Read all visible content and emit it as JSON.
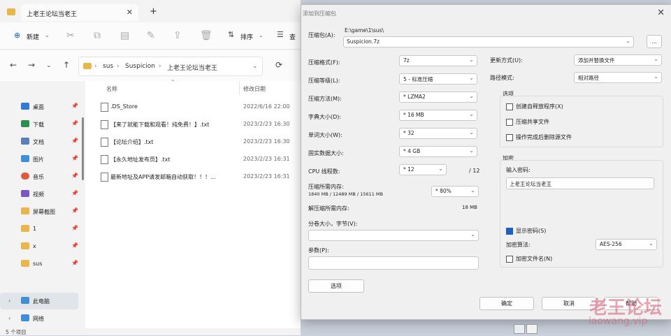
{
  "explorer": {
    "tab_title": "上老王论坛当老王",
    "tab_close": "✕",
    "tab_add": "+",
    "toolbar": {
      "new_label": "新建",
      "sort_label": "排序",
      "view_label": "查"
    },
    "breadcrumb": [
      "sus",
      "Suspicion",
      "上老王论坛当老王"
    ],
    "columns": {
      "name": "名称",
      "date": "修改日期"
    },
    "sidebar": [
      {
        "label": "桌面",
        "color": "#2f7ad6"
      },
      {
        "label": "下载",
        "color": "#2d8f4e"
      },
      {
        "label": "文档",
        "color": "#5b7fb8"
      },
      {
        "label": "图片",
        "color": "#3f8fd8"
      },
      {
        "label": "音乐",
        "color": "#e05a3c"
      },
      {
        "label": "视频",
        "color": "#7b57c4"
      },
      {
        "label": "屏幕截图",
        "color": "#e8b64a"
      },
      {
        "label": "1",
        "color": "#e8b64a"
      },
      {
        "label": "x",
        "color": "#e8b64a"
      },
      {
        "label": "sus",
        "color": "#e8b64a"
      }
    ],
    "this_pc": "此电脑",
    "network": "网络",
    "files": [
      {
        "name": ".DS_Store",
        "date": "2022/6/16 22:00"
      },
      {
        "name": "【来了就能下载和观看！纯免费！】.txt",
        "date": "2023/2/23 16:30"
      },
      {
        "name": "【论坛介绍】.txt",
        "date": "2023/2/23 16:30"
      },
      {
        "name": "【永久地址发布页】.txt",
        "date": "2023/2/23 16:31"
      },
      {
        "name": "最新地址及APP请发邮箱自动获取！！！...",
        "date": "2023/2/23 16:31"
      }
    ],
    "status": "5 个项目"
  },
  "dialog": {
    "title": "添加到压缩包",
    "close": "✕",
    "archive_label": "压缩包(A):",
    "archive_dir": "E:\\game\\1\\sus\\",
    "archive_name": "Suspicion.7z",
    "browse": "...",
    "left": [
      {
        "label": "压缩格式(F):",
        "value": "7z"
      },
      {
        "label": "压缩等级(L):",
        "value": "5 - 标准压缩"
      },
      {
        "label": "压缩方法(M):",
        "value": "* LZMA2"
      },
      {
        "label": "字典大小(D):",
        "value": "* 16 MB"
      },
      {
        "label": "单词大小(W):",
        "value": "* 32"
      },
      {
        "label": "固实数据大小:",
        "value": "* 4 GB"
      }
    ],
    "cpu_label": "CPU 线程数:",
    "cpu_value": "* 12",
    "cpu_max": "/ 12",
    "mem_label": "压缩所需内存:",
    "mem_detail": "1840 MB / 12489 MB / 15611 MB",
    "mem_value": "* 80%",
    "decomp_label": "解压缩所需内存:",
    "decomp_value": "18 MB",
    "split_label": "分卷大小，字节(V):",
    "params_label": "参数(P):",
    "options_btn": "选项",
    "update_label": "更新方式(U):",
    "update_value": "添加并替换文件",
    "path_label": "路径模式:",
    "path_value": "相对路径",
    "options_group": "选项",
    "option_items": [
      "创建自释放程序(X)",
      "压缩共享文件",
      "操作完成后删除源文件"
    ],
    "encrypt_group": "加密",
    "password_label": "输入密码:",
    "password_value": "上老王论坛当老王",
    "show_password": "显示密码(S)",
    "enc_method_label": "加密算法:",
    "enc_method_value": "AES-256",
    "encrypt_names": "加密文件名(N)",
    "ok": "确定",
    "cancel": "取消",
    "help": "帮助"
  },
  "watermark": {
    "cn": "老王论坛",
    "url": "laowang.vip"
  }
}
